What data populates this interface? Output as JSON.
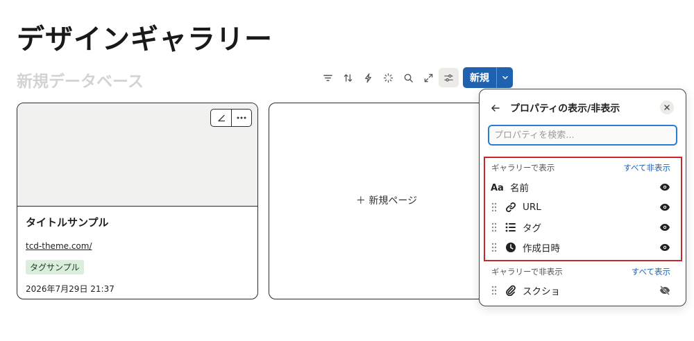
{
  "page": {
    "title": "デザインギャラリー",
    "database_name": "新規データベース"
  },
  "toolbar": {
    "icons": [
      "filter-icon",
      "sort-icon",
      "automation-icon",
      "ai-sparkle-icon",
      "search-icon",
      "expand-icon",
      "settings-sliders-icon"
    ],
    "new_label": "新規"
  },
  "cards": [
    {
      "title": "タイトルサンプル",
      "url": "tcd-theme.com/",
      "tag": "タグサンプル",
      "date": "2026年7月29日 21:37"
    }
  ],
  "new_page_label": "＋ 新規ページ",
  "property_panel": {
    "title": "プロパティの表示/非表示",
    "search_placeholder": "プロパティを検索...",
    "shown_section": {
      "label": "ギャラリーで表示",
      "action": "すべて非表示",
      "items": [
        {
          "name": "名前",
          "icon": "text-aa-icon"
        },
        {
          "name": "URL",
          "icon": "link-icon"
        },
        {
          "name": "タグ",
          "icon": "list-icon"
        },
        {
          "name": "作成日時",
          "icon": "clock-icon"
        }
      ]
    },
    "hidden_section": {
      "label": "ギャラリーで非表示",
      "action": "すべて表示",
      "items": [
        {
          "name": "スクショ",
          "icon": "paperclip-icon"
        }
      ]
    }
  },
  "colors": {
    "accent": "#1f62b0",
    "highlight_border": "#c62828",
    "tag_bg": "#dbeddb"
  }
}
